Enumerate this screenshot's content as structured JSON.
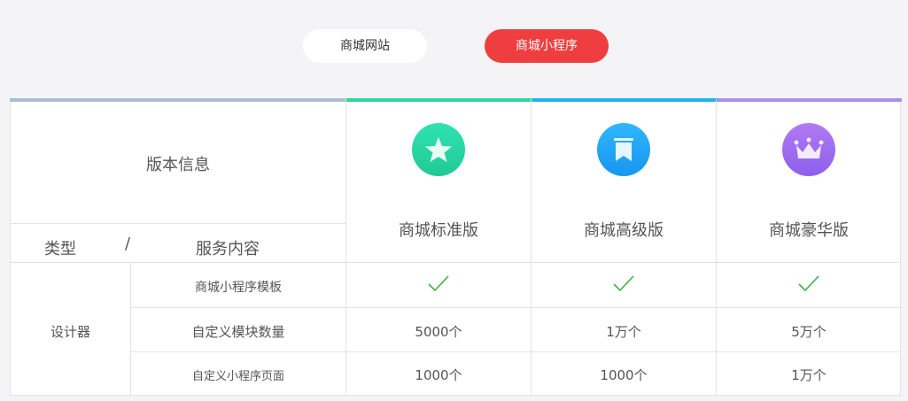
{
  "tabs": {
    "site": "商城网站",
    "mini_program": "商城小程序"
  },
  "table": {
    "header": {
      "version_info": "版本信息",
      "type": "类型",
      "slash": "/",
      "service": "服务内容"
    },
    "plans": [
      {
        "name": "商城标准版",
        "icon": "star-icon",
        "color": "#2dd3a0"
      },
      {
        "name": "商城高级版",
        "icon": "bookmark-icon",
        "color": "#1ea7f3"
      },
      {
        "name": "商城豪华版",
        "icon": "crown-icon",
        "color": "#a46ef0"
      }
    ],
    "category": "设计器",
    "rows": [
      {
        "label": "商城小程序模板",
        "values": [
          "✓",
          "✓",
          "✓"
        ]
      },
      {
        "label": "自定义模块数量",
        "values": [
          "5000个",
          "1万个",
          "5万个"
        ]
      },
      {
        "label": "自定义小程序页面",
        "values": [
          "1000个",
          "1000个",
          "1万个"
        ]
      }
    ],
    "top_bar_colors": [
      "#a9bdd3",
      "#2fd49e",
      "#1eb2ef",
      "#a98ef2"
    ]
  }
}
